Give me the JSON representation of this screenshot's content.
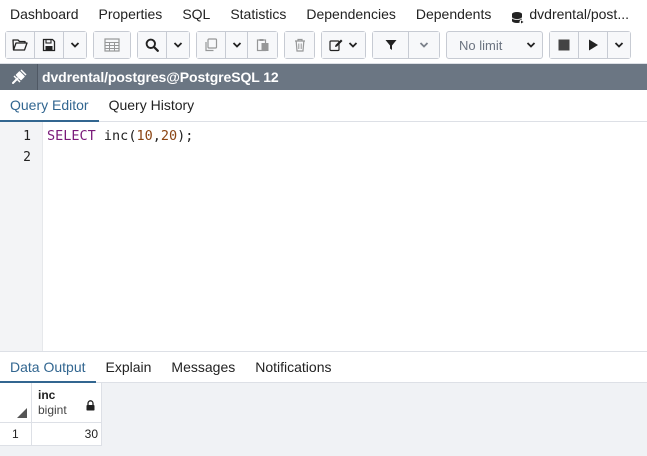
{
  "top_tabs": [
    "Dashboard",
    "Properties",
    "SQL",
    "Statistics",
    "Dependencies",
    "Dependents",
    "dvdrental/post..."
  ],
  "toolbar": {
    "limit_label": "No limit",
    "icons": [
      "open-file-icon",
      "save-icon",
      "chevron-down-icon",
      "edit-grid-icon",
      "search-icon",
      "chevron-down-icon",
      "copy-icon",
      "chevron-down-icon",
      "paste-icon",
      "delete-icon",
      "edit-icon",
      "chevron-down-icon",
      "filter-icon",
      "chevron-down-icon",
      "stop-icon",
      "play-icon",
      "chevron-down-icon"
    ]
  },
  "connection": {
    "title": "dvdrental/postgres@PostgreSQL 12",
    "icon": "connection-plug-icon"
  },
  "editor_tabs": [
    {
      "label": "Query Editor",
      "active": true
    },
    {
      "label": "Query History",
      "active": false
    }
  ],
  "editor": {
    "line_numbers": [
      "1",
      "2"
    ],
    "code": {
      "keyword": "SELECT",
      "space": " ",
      "function": "inc",
      "open": "(",
      "arg1": "10",
      "comma": ",",
      "arg2": "20",
      "close": ");"
    }
  },
  "output_tabs": [
    {
      "label": "Data Output",
      "active": true
    },
    {
      "label": "Explain",
      "active": false
    },
    {
      "label": "Messages",
      "active": false
    },
    {
      "label": "Notifications",
      "active": false
    }
  ],
  "grid": {
    "columns": [
      {
        "name": "inc",
        "type": "bigint"
      }
    ],
    "rows": [
      {
        "row_number": "1",
        "values": [
          "30"
        ]
      }
    ]
  },
  "colors": {
    "accent": "#326690",
    "connection_bar": "#6b7683",
    "keyword": "#7a1a7a",
    "number": "#8b4513"
  }
}
